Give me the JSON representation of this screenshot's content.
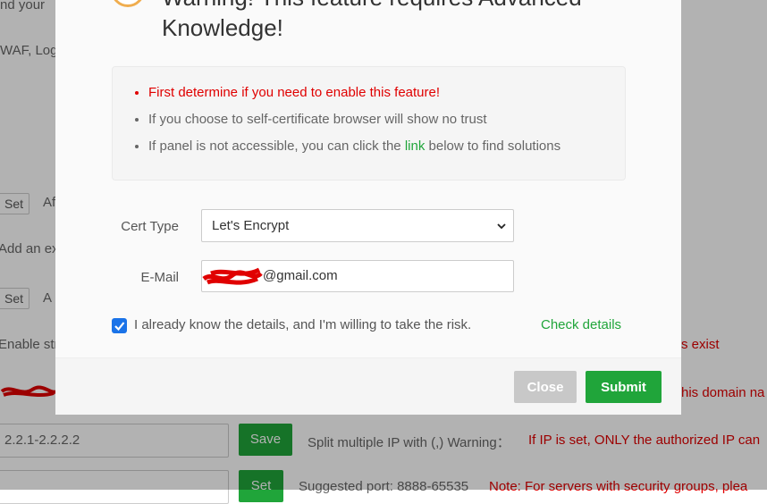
{
  "background": {
    "frag_top": "nd your",
    "frag_waf": "WAF, Log",
    "set_label": "Set",
    "frag_af": "Af",
    "frag_add": "Add an ex",
    "frag_a": "A",
    "frag_enable": "Enable str",
    "frag_exist": "s exist",
    "frag_domain": "his domain na",
    "ip_value": "2.2.1-2.2.2.2",
    "save_label": "Save",
    "split_hint": "Split multiple IP with (,) Warning：",
    "split_warn": "If IP is set, ONLY the authorized IP can",
    "port_hint": "Suggested port: 8888-65535",
    "port_warn": "Note: For servers with security groups, plea"
  },
  "modal": {
    "title": "Warning! This feature requires Advanced Knowledge!",
    "notices": {
      "n1": "First determine if you need to enable this feature!",
      "n2": "If you choose to self-certificate browser will show no trust",
      "n3_before": "If panel is not accessible, you can click the ",
      "n3_link": "link",
      "n3_after": " below to find solutions"
    },
    "cert_type_label": "Cert Type",
    "cert_type_value": "Let's Encrypt",
    "email_label": "E-Mail",
    "email_value": "@gmail.com",
    "checkbox_label": "I already know the details, and I'm willing to take the risk.",
    "check_details": "Check details",
    "close_label": "Close",
    "submit_label": "Submit"
  },
  "colors": {
    "accent": "#20a53a",
    "danger": "#e00000",
    "checkbox": "#1a73e8",
    "close_btn": "#c8c8c8"
  }
}
